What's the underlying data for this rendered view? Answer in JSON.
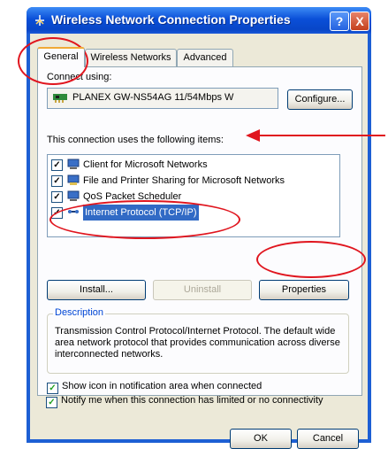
{
  "window": {
    "title": "Wireless Network Connection Properties",
    "help_symbol": "?",
    "close_symbol": "X"
  },
  "tabs": [
    {
      "label": "General",
      "active": true
    },
    {
      "label": "Wireless Networks",
      "active": false
    },
    {
      "label": "Advanced",
      "active": false
    }
  ],
  "general": {
    "connect_using_label": "Connect using:",
    "adapter_name": "PLANEX GW-NS54AG 11/54Mbps W",
    "configure_button": "Configure...",
    "items_label": "This connection uses the following items:",
    "items": [
      {
        "label": "Client for Microsoft Networks",
        "checked": true,
        "icon": "network-client-icon"
      },
      {
        "label": "File and Printer Sharing for Microsoft Networks",
        "checked": true,
        "icon": "file-sharing-icon"
      },
      {
        "label": "QoS Packet Scheduler",
        "checked": true,
        "icon": "qos-icon"
      },
      {
        "label": "Internet Protocol (TCP/IP)",
        "checked": true,
        "selected": true,
        "icon": "protocol-icon"
      }
    ],
    "install_button": "Install...",
    "uninstall_button": "Uninstall",
    "properties_button": "Properties",
    "description_title": "Description",
    "description_text": "Transmission Control Protocol/Internet Protocol. The default wide area network protocol that provides communication across diverse interconnected networks.",
    "show_icon_label": "Show icon in notification area when connected",
    "show_icon_checked": true,
    "notify_label": "Notify me when this connection has limited or no connectivity",
    "notify_checked": true
  },
  "footer": {
    "ok_button": "OK",
    "cancel_button": "Cancel"
  },
  "annotation_color": "#e0151e"
}
